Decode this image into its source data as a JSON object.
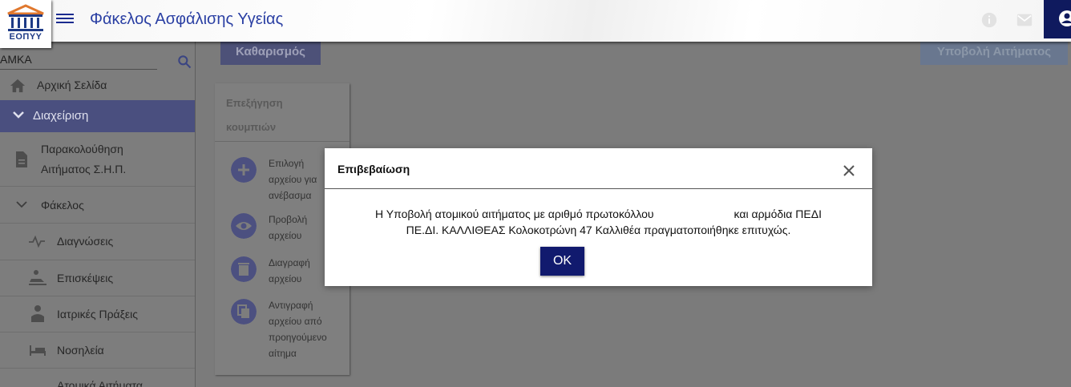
{
  "header": {
    "logo_text": "ΕΟΠΥΥ",
    "title": "Φάκελος Ασφάλισης Υγείας",
    "icons": [
      "menu-icon",
      "info-icon",
      "mail-icon",
      "user-icon"
    ]
  },
  "sidebar": {
    "search_label": "ΑΜΚΑ",
    "items": [
      {
        "label": "Αρχική Σελίδα",
        "icon": "home-icon"
      },
      {
        "label": "Διαχείριση",
        "icon": "chevron-down-icon"
      },
      {
        "label": "Παρακολούθηση Αιτήματος Σ.Η.Π.",
        "line1": "Παρακολούθηση",
        "line2": "Αιτήματος Σ.Η.Π.",
        "icon": "document-icon"
      },
      {
        "label": "Φάκελος",
        "icon": "chevron-down-icon"
      },
      {
        "label": "Διαγνώσεις",
        "icon": "pulse-icon"
      },
      {
        "label": "Επισκέψεις",
        "icon": "visit-icon"
      },
      {
        "label": "Ιατρικές Πράξεις",
        "icon": "doctor-icon"
      },
      {
        "label": "Νοσηλεία",
        "icon": "bed-icon"
      },
      {
        "label": "Ατομικά Αιτήματα",
        "icon": "request-icon"
      }
    ]
  },
  "toolbar": {
    "clear_label": "Καθαρισμός",
    "submit_label": "Υποβολή Αιτήματος"
  },
  "legend": {
    "title_line1": "Επεξήγηση",
    "title_line2": "κουμπιών",
    "rows": [
      {
        "icon": "add-circle-icon",
        "lines": [
          "Επιλογή",
          "αρχείου για",
          "ανέβασμα"
        ]
      },
      {
        "icon": "eye-icon",
        "lines": [
          "Προβολή",
          "αρχείου"
        ]
      },
      {
        "icon": "trash-icon",
        "lines": [
          "Διαγραφή",
          "αρχείου"
        ]
      },
      {
        "icon": "copy-icon",
        "lines": [
          "Αντιγραφή",
          "αρχείου από",
          "προηγούμενο",
          "αίτημα"
        ]
      }
    ]
  },
  "modal": {
    "title": "Επιβεβαίωση",
    "message_part1": "Η Υποβολή ατομικού αιτήματος με αριθμό πρωτοκόλλου",
    "message_part2": "και αρμόδια ΠΕΔΙ",
    "message_line2": "ΠΕ.ΔΙ. ΚΑΛΛΙΘΕΑΣ Κολοκοτρώνη 47 Καλλιθέα πραγματοποιήθηκε επιτυχώς.",
    "ok_label": "OK"
  },
  "colors": {
    "accent": "#111a6e",
    "title_blue": "#2a3fa3",
    "active_item_bg": "#4a4f7f"
  }
}
